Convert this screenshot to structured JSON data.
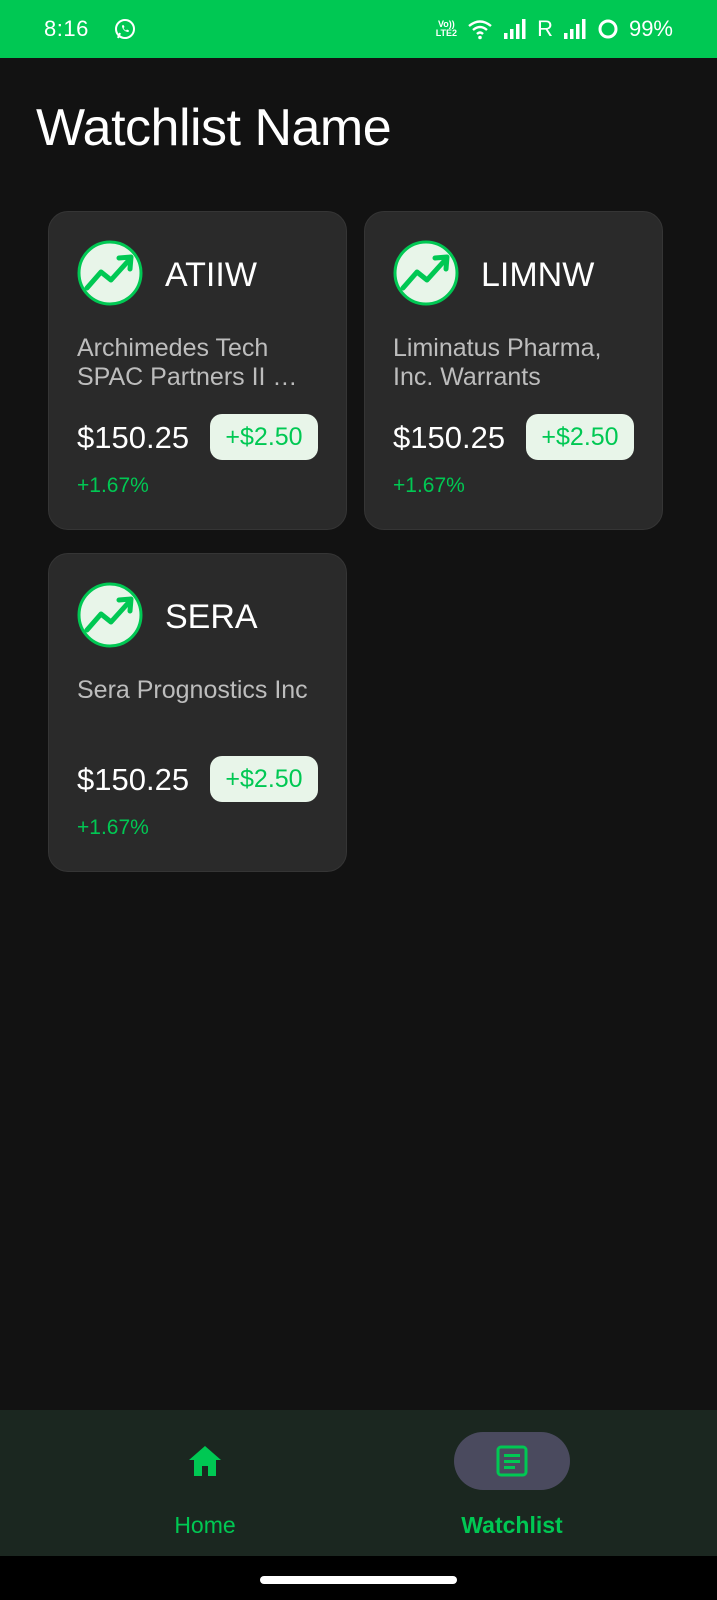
{
  "status_bar": {
    "time": "8:16",
    "network_label": "R",
    "battery": "99%",
    "volte_line1": "Vo))",
    "volte_line2": "LTE2"
  },
  "page": {
    "title": "Watchlist Name"
  },
  "colors": {
    "accent": "#00c853",
    "background": "#121212",
    "card": "#2a2a2a",
    "badge_bg": "#e8f5e9",
    "nav_bg": "#1b2720",
    "nav_active_pill": "#4a4a5e"
  },
  "cards": [
    {
      "icon": "trend-up-icon",
      "ticker": "ATIIW",
      "company": "Archimedes Tech SPAC Partners II …",
      "price": "$150.25",
      "change": "+$2.50",
      "percent": "+1.67%"
    },
    {
      "icon": "trend-up-icon",
      "ticker": "LIMNW",
      "company": "Liminatus Pharma, Inc. Warrants",
      "price": "$150.25",
      "change": "+$2.50",
      "percent": "+1.67%"
    },
    {
      "icon": "trend-up-icon",
      "ticker": "SERA",
      "company": "Sera Prognostics Inc",
      "price": "$150.25",
      "change": "+$2.50",
      "percent": "+1.67%"
    }
  ],
  "bottom_nav": {
    "items": [
      {
        "label": "Home",
        "icon": "home-icon",
        "active": false
      },
      {
        "label": "Watchlist",
        "icon": "list-icon",
        "active": true
      }
    ]
  }
}
